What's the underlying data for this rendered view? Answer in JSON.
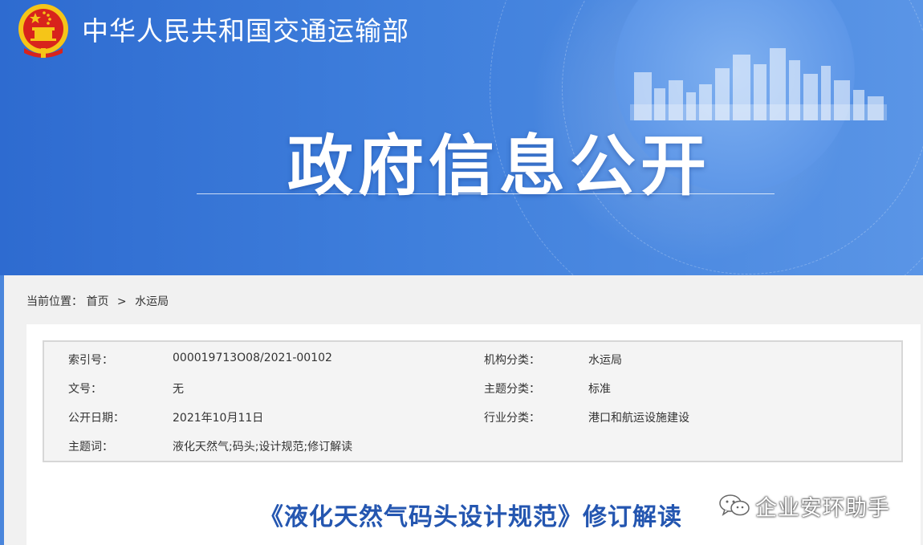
{
  "header": {
    "ministry_name": "中华人民共和国交通运输部",
    "section_title": "政府信息公开"
  },
  "breadcrumb": {
    "prefix": "当前位置：",
    "home": "首页",
    "separator": ">",
    "current": "水运局"
  },
  "metadata": {
    "index_label": "索引号：",
    "index_value": "000019713O08/2021-00102",
    "org_label": "机构分类：",
    "org_value": "水运局",
    "doc_no_label": "文号：",
    "doc_no_value": "无",
    "topic_label": "主题分类：",
    "topic_value": "标准",
    "date_label": "公开日期：",
    "date_value": "2021年10月11日",
    "industry_label": "行业分类：",
    "industry_value": "港口和航运设施建设",
    "keywords_label": "主题词：",
    "keywords_value": "液化天然气;码头;设计规范;修订解读"
  },
  "article": {
    "title": "《液化天然气码头设计规范》修订解读"
  },
  "watermark": {
    "text": "企业安环助手"
  },
  "icons": {
    "emblem": "national-emblem-icon",
    "skyline": "city-skyline-graphic",
    "wechat": "wechat-icon"
  },
  "colors": {
    "banner": "#3f7fdc",
    "title_blue": "#2456b0",
    "emblem_red": "#d8231c",
    "emblem_gold": "#f5c518"
  }
}
